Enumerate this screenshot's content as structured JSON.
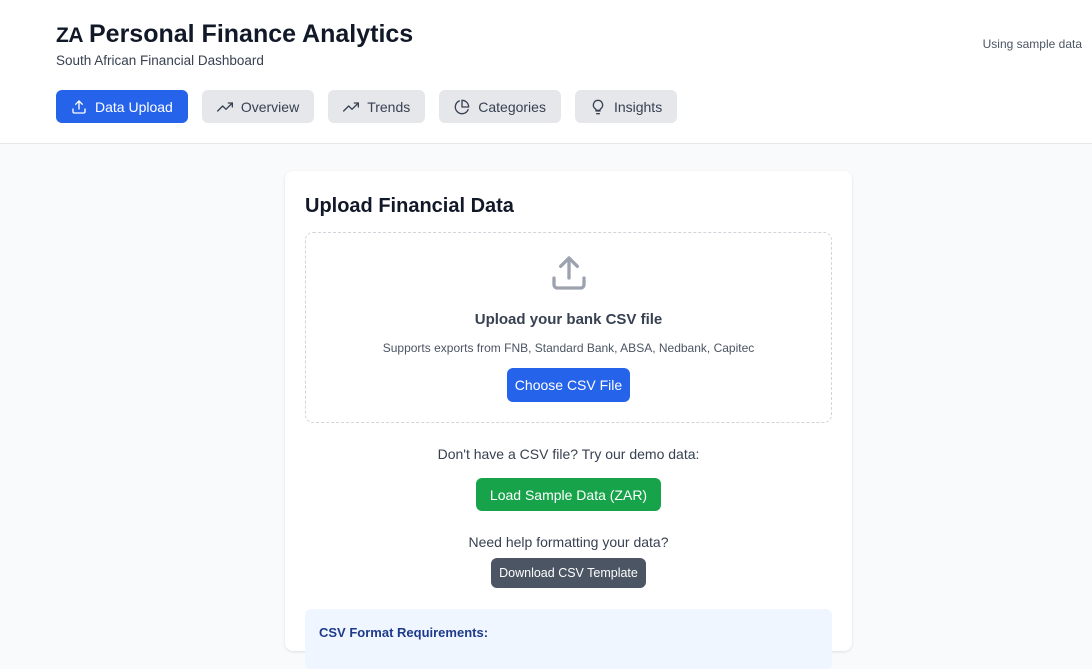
{
  "header": {
    "flag_code": "ZA",
    "title": "Personal Finance Analytics",
    "subtitle": "South African Financial Dashboard",
    "status_note": "Using sample data"
  },
  "nav": {
    "tabs": [
      {
        "label": "Data Upload",
        "icon": "upload-icon",
        "active": true
      },
      {
        "label": "Overview",
        "icon": "trending-up-icon",
        "active": false
      },
      {
        "label": "Trends",
        "icon": "trending-up-icon",
        "active": false
      },
      {
        "label": "Categories",
        "icon": "pie-chart-icon",
        "active": false
      },
      {
        "label": "Insights",
        "icon": "lightbulb-icon",
        "active": false
      }
    ]
  },
  "upload": {
    "title": "Upload Financial Data",
    "dropzone_icon": "upload-icon",
    "dropzone_title": "Upload your bank CSV file",
    "dropzone_subtitle": "Supports exports from FNB, Standard Bank, ABSA, Nedbank, Capitec",
    "choose_label": "Choose CSV File",
    "demo_prompt": "Don't have a CSV file? Try our demo data:",
    "sample_label": "Load Sample Data (ZAR)",
    "help_prompt": "Need help formatting your data?",
    "template_label": "Download CSV Template",
    "requirements_title": "CSV Format Requirements:"
  },
  "colors": {
    "primary": "#2563eb",
    "success": "#16a34a",
    "secondary": "#4b5563",
    "info_bg": "#eff6ff"
  }
}
